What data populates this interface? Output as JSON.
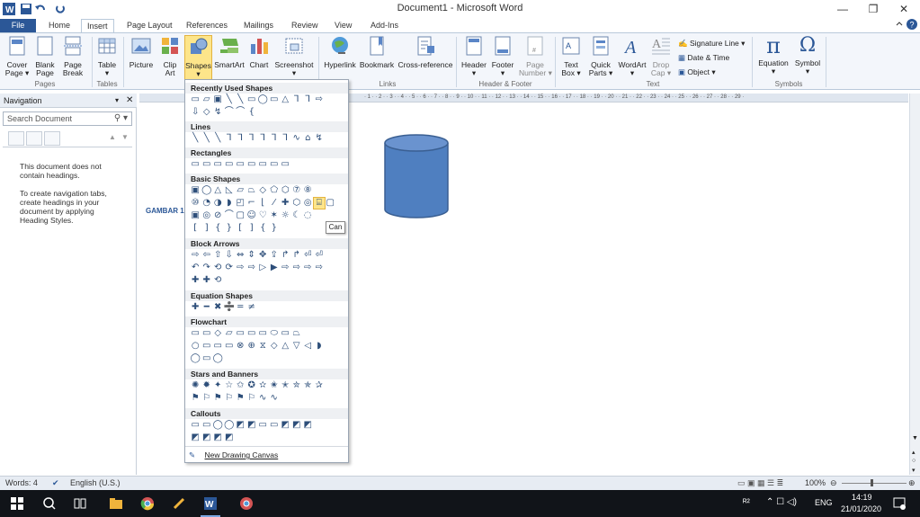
{
  "window": {
    "title": "Document1 - Microsoft Word",
    "controls": {
      "minimize": "—",
      "restore": "❐",
      "close": "✕"
    }
  },
  "tabs": [
    "File",
    "Home",
    "Insert",
    "Page Layout",
    "References",
    "Mailings",
    "Review",
    "View",
    "Add-Ins"
  ],
  "ribbon": {
    "buttons": {
      "cover_page": "Cover\nPage ▾",
      "blank_page": "Blank\nPage",
      "page_break": "Page\nBreak",
      "table": "Table\n▾",
      "picture": "Picture",
      "clip_art": "Clip\nArt",
      "shapes": "Shapes\n▾",
      "smartart": "SmartArt",
      "chart": "Chart",
      "screenshot": "Screenshot\n▾",
      "hyperlink": "Hyperlink",
      "bookmark": "Bookmark",
      "cross_reference": "Cross-reference",
      "header": "Header\n▾",
      "footer": "Footer\n▾",
      "page_number": "Page\nNumber ▾",
      "text_box": "Text\nBox ▾",
      "quick_parts": "Quick\nParts ▾",
      "wordart": "WordArt\n▾",
      "drop_cap": "Drop\nCap ▾",
      "signature_line": "Signature Line ▾",
      "date_time": "Date & Time",
      "object": "Object ▾",
      "equation": "Equation\n▾",
      "symbol": "Symbol\n▾"
    },
    "groups": [
      "Pages",
      "Tables",
      "Links",
      "Header & Footer",
      "Text",
      "Symbols"
    ]
  },
  "navigation": {
    "title": "Navigation",
    "search_placeholder": "Search Document",
    "message1": "This document does not contain headings.",
    "message2": "To create navigation tabs, create headings in your document by applying Heading Styles."
  },
  "document": {
    "side_label": "GAMBAR 1"
  },
  "ruler_text": "· 1 · · 2 · · 3 · · 4 · · 5 · · 6 · · 7 · · 8 · · 9 · · 10 · · 11 · · 12 · · 13 · · 14 · · 15 · · 16 · · 17 · · 18 · · 19 · · 20 · · 21 · · 22 · · 23 · · 24 · · 25 · · 26 · · 27 · · 28 · · 29 ·",
  "shapes_menu": {
    "sections": [
      "Recently Used Shapes",
      "Lines",
      "Rectangles",
      "Basic Shapes",
      "Block Arrows",
      "Equation Shapes",
      "Flowchart",
      "Stars and Banners",
      "Callouts"
    ],
    "rows": {
      "recent1": "▭▱▣╲╲▭◯▭△⅂⅂⇨",
      "recent2": "⇩◇↯⌒⌒{",
      "lines": "╲╲╲⅂⅂⅂⅂⅂⅂∿⌂↯",
      "rectangles": "▭▭▭▭▭▭▭▭▭",
      "basic1": "▣◯△◺▱⏢◇⬠⬡⑦⑧",
      "basic2": "⑩◔◑◗◰⌐⌊⁄✚⬡◎▢",
      "basic3": "▣◎⊘⌒▢☺♡✶☼☾◌",
      "basic4": "[]{}[]{}",
      "arrows1": "⇨⇦⇧⇩⇔⇕✥⇪↱↱⏎⏎",
      "arrows2": "↶↷⟲⟳⇨⇨▷▶⇨⇨⇨⇨",
      "arrows3": "✚✚⟲",
      "equation": "✚━✖➗═≠",
      "flow1": "▭▭◇▱▭▭▭⬭▭⏢",
      "flow2": "○▭▭▭⊗⊕⧖◇△▽◁◗",
      "flow3": "◯▭◯",
      "stars1": "✺✹✦☆✩✪✫✬✭✮✯✰",
      "stars2": "⚑⚐⚑⚐⚑⚐∿∿",
      "callouts1": "▭▭◯◯◩◩▭▭◩◩◩",
      "callouts2": "◩◩◩◩"
    },
    "footer": "New Drawing Canvas"
  },
  "tooltip": "Can",
  "statusbar": {
    "words": "Words: 4",
    "language": "English (U.S.)",
    "zoom": "100%"
  },
  "taskbar": {
    "language": "ENG",
    "time": "14:19",
    "date": "21/01/2020"
  },
  "colors": {
    "file_tab": "#2b5797",
    "can_fill": "#4f7fc0",
    "can_stroke": "#3a5f92",
    "selected": "#fde58a"
  }
}
